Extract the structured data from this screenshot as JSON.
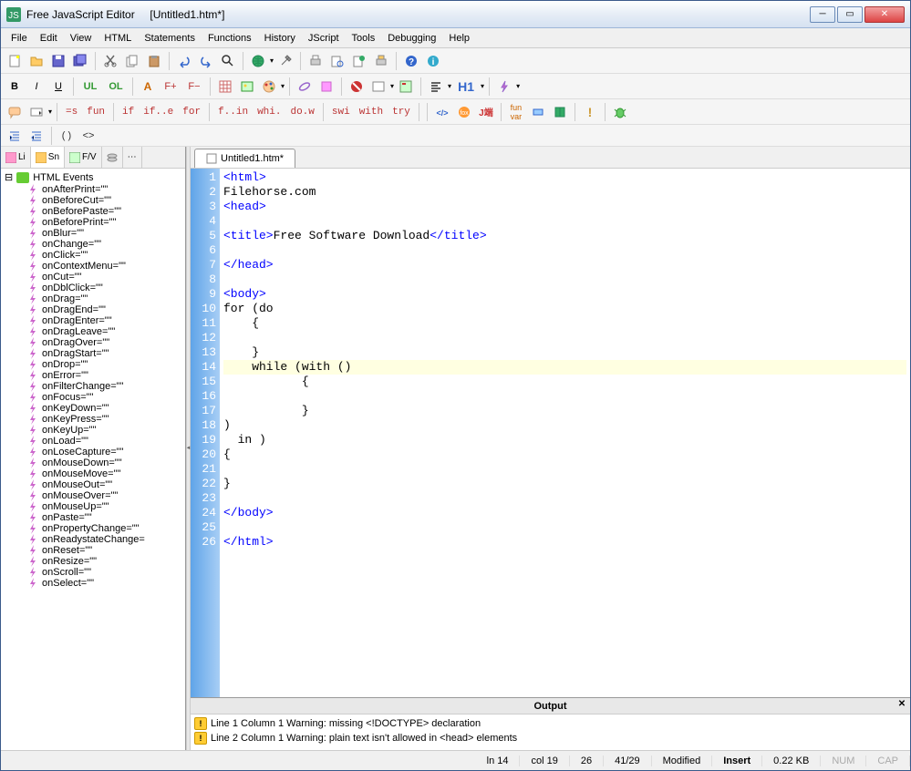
{
  "window": {
    "app_name": "Free JavaScript Editor",
    "doc_title": "[Untitled1.htm*]"
  },
  "menu": [
    "File",
    "Edit",
    "View",
    "HTML",
    "Statements",
    "Functions",
    "History",
    "JScript",
    "Tools",
    "Debugging",
    "Help"
  ],
  "toolbar2": {
    "bold": "B",
    "italic": "I",
    "underline": "U",
    "ul": "UL",
    "ol": "OL",
    "fplus": "F+",
    "fminus": "F−",
    "h1": "H1"
  },
  "toolbar3": {
    "snippets": [
      "=s",
      "fun",
      "if",
      "if..e",
      "for",
      "f..in",
      "whi.",
      "do.w",
      "swi",
      "with",
      "try"
    ]
  },
  "sidebar": {
    "tabs": [
      "Li",
      "Sn",
      "F/V"
    ],
    "root": "HTML Events",
    "items": [
      "onAfterPrint=\"\"",
      "onBeforeCut=\"\"",
      "onBeforePaste=\"\"",
      "onBeforePrint=\"\"",
      "onBlur=\"\"",
      "onChange=\"\"",
      "onClick=\"\"",
      "onContextMenu=\"\"",
      "onCut=\"\"",
      "onDblClick=\"\"",
      "onDrag=\"\"",
      "onDragEnd=\"\"",
      "onDragEnter=\"\"",
      "onDragLeave=\"\"",
      "onDragOver=\"\"",
      "onDragStart=\"\"",
      "onDrop=\"\"",
      "onError=\"\"",
      "onFilterChange=\"\"",
      "onFocus=\"\"",
      "onKeyDown=\"\"",
      "onKeyPress=\"\"",
      "onKeyUp=\"\"",
      "onLoad=\"\"",
      "onLoseCapture=\"\"",
      "onMouseDown=\"\"",
      "onMouseMove=\"\"",
      "onMouseOut=\"\"",
      "onMouseOver=\"\"",
      "onMouseUp=\"\"",
      "onPaste=\"\"",
      "onPropertyChange=\"\"",
      "onReadystateChange=",
      "onReset=\"\"",
      "onResize=\"\"",
      "onScroll=\"\"",
      "onSelect=\"\""
    ]
  },
  "editor": {
    "tab_name": "Untitled1.htm*",
    "lines": [
      {
        "n": 1,
        "html": "<span class='tag'>&lt;html&gt;</span>"
      },
      {
        "n": 2,
        "html": "<span class='txt'>Filehorse.com</span>"
      },
      {
        "n": 3,
        "html": "<span class='tag'>&lt;head&gt;</span>"
      },
      {
        "n": 4,
        "html": ""
      },
      {
        "n": 5,
        "html": "<span class='tag'>&lt;title&gt;</span><span class='txt'>Free Software Download</span><span class='tag'>&lt;/title&gt;</span>"
      },
      {
        "n": 6,
        "html": ""
      },
      {
        "n": 7,
        "html": "<span class='tag'>&lt;/head&gt;</span>"
      },
      {
        "n": 8,
        "html": ""
      },
      {
        "n": 9,
        "html": "<span class='tag'>&lt;body&gt;</span>"
      },
      {
        "n": 10,
        "html": "<span class='txt'>for (do</span>"
      },
      {
        "n": 11,
        "html": "<span class='txt'>    {</span>"
      },
      {
        "n": 12,
        "html": ""
      },
      {
        "n": 13,
        "html": "<span class='txt'>    }</span>"
      },
      {
        "n": 14,
        "html": "<span class='txt'>    while (with ()</span>",
        "hl": true
      },
      {
        "n": 15,
        "html": "<span class='txt'>           {</span>"
      },
      {
        "n": 16,
        "html": ""
      },
      {
        "n": 17,
        "html": "<span class='txt'>           }</span>"
      },
      {
        "n": 18,
        "html": "<span class='txt'>)</span>"
      },
      {
        "n": 19,
        "html": "<span class='txt'>  in )</span>"
      },
      {
        "n": 20,
        "html": "<span class='txt'>{</span>"
      },
      {
        "n": 21,
        "html": ""
      },
      {
        "n": 22,
        "html": "<span class='txt'>}</span>"
      },
      {
        "n": 23,
        "html": ""
      },
      {
        "n": 24,
        "html": "<span class='tag'>&lt;/body&gt;</span>"
      },
      {
        "n": 25,
        "html": ""
      },
      {
        "n": 26,
        "html": "<span class='tag'>&lt;/html&gt;</span>"
      }
    ]
  },
  "output": {
    "title": "Output",
    "lines": [
      "Line 1 Column 1  Warning: missing <!DOCTYPE> declaration",
      "Line 2 Column 1  Warning: plain text isn't allowed in <head> elements"
    ]
  },
  "status": {
    "ln": "ln 14",
    "col": "col 19",
    "sel": "26",
    "pos": "41/29",
    "mod": "Modified",
    "ins": "Insert",
    "size": "0.22 KB",
    "num": "NUM",
    "cap": "CAP"
  }
}
